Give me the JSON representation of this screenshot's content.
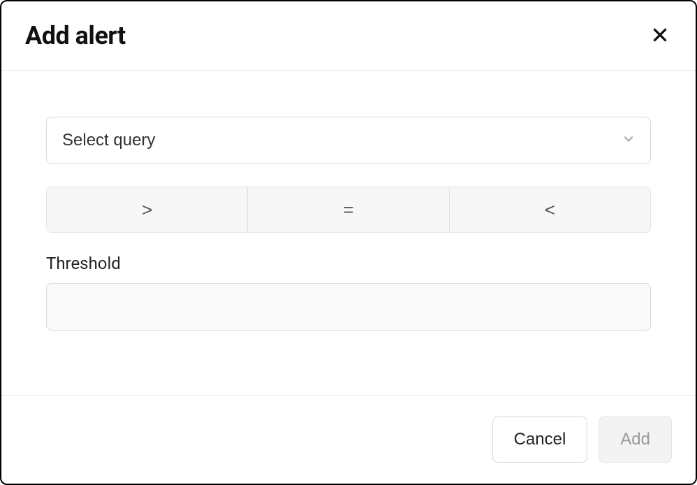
{
  "modal": {
    "title": "Add alert"
  },
  "form": {
    "query_placeholder": "Select query",
    "operators": {
      "gt": ">",
      "eq": "=",
      "lt": "<"
    },
    "threshold_label": "Threshold",
    "threshold_value": ""
  },
  "footer": {
    "cancel": "Cancel",
    "add": "Add"
  }
}
